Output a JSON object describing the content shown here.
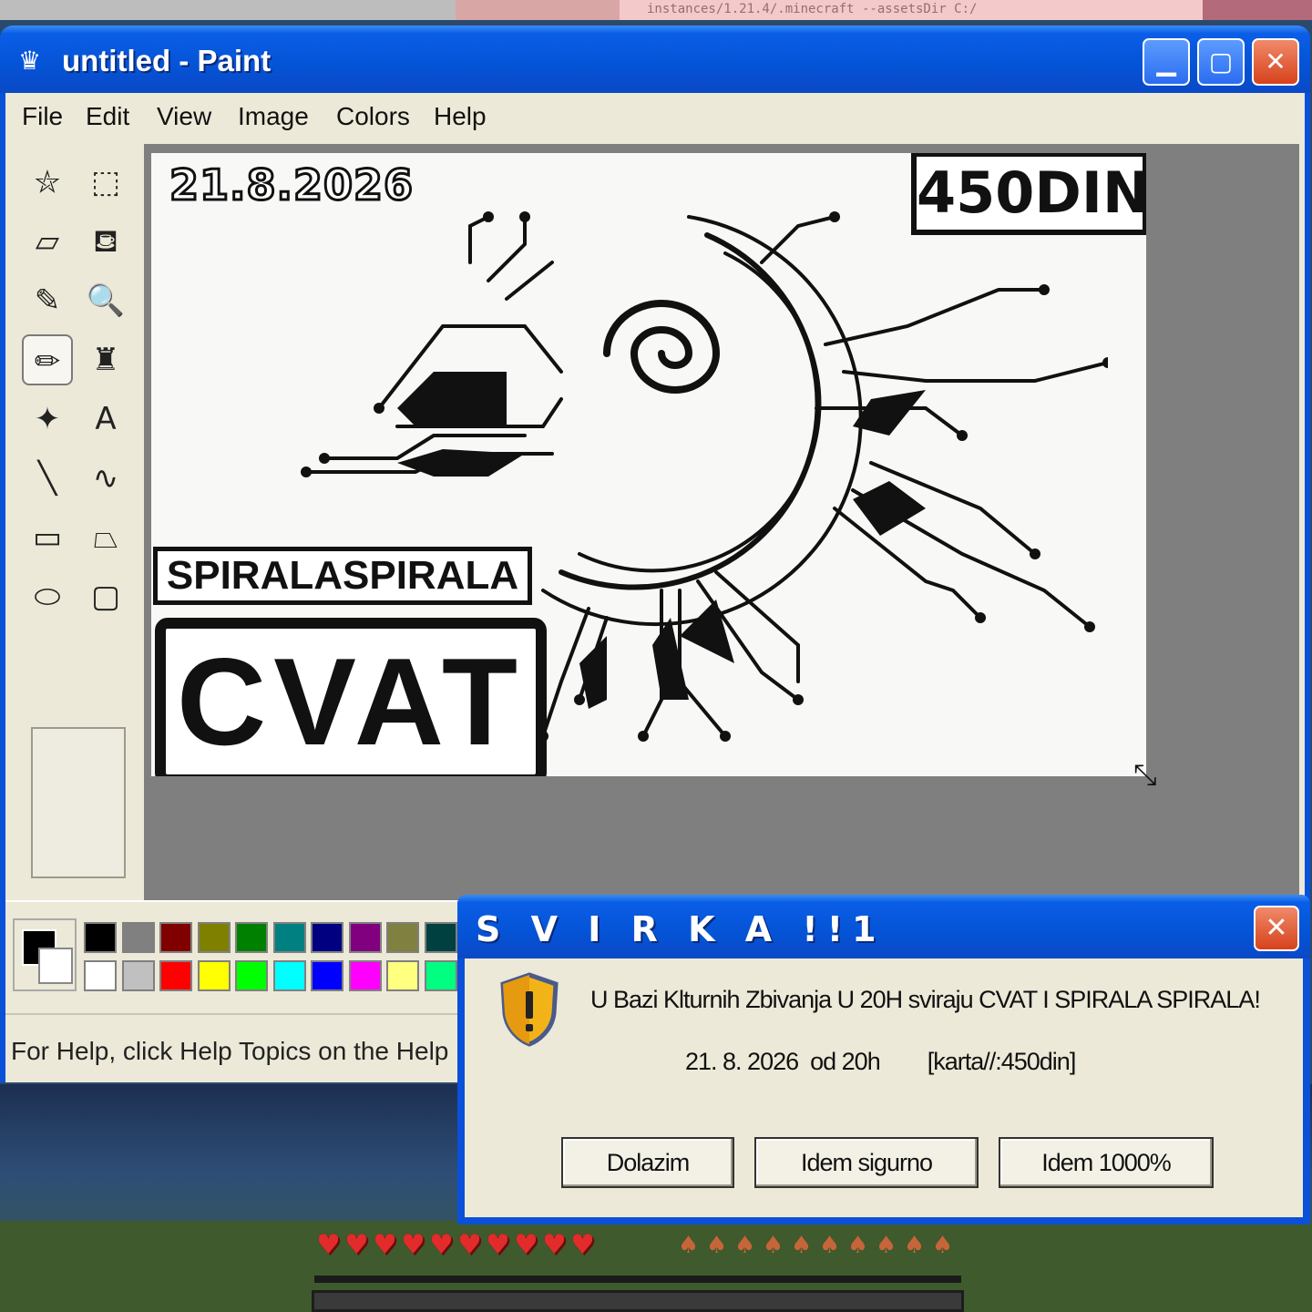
{
  "background": {
    "terminal_text": "instances/1.21.4/.minecraft --assetsDir C:/"
  },
  "paint": {
    "title": "untitled - Paint",
    "menu": [
      "File",
      "Edit",
      "View",
      "Image",
      "Colors",
      "Help"
    ],
    "tools": [
      {
        "name": "free-form-select-icon",
        "glyph": "⛦"
      },
      {
        "name": "rect-select-icon",
        "glyph": "⬚"
      },
      {
        "name": "eraser-icon",
        "glyph": "▱"
      },
      {
        "name": "fill-bucket-icon",
        "glyph": "⛾"
      },
      {
        "name": "eyedropper-icon",
        "glyph": "✎"
      },
      {
        "name": "magnifier-icon",
        "glyph": "🔍"
      },
      {
        "name": "pencil-icon",
        "glyph": "✏"
      },
      {
        "name": "brush-icon",
        "glyph": "♜"
      },
      {
        "name": "airbrush-icon",
        "glyph": "✦"
      },
      {
        "name": "text-icon",
        "glyph": "A"
      },
      {
        "name": "line-icon",
        "glyph": "╲"
      },
      {
        "name": "curve-icon",
        "glyph": "∿"
      },
      {
        "name": "rectangle-icon",
        "glyph": "▭"
      },
      {
        "name": "polygon-icon",
        "glyph": "⏢"
      },
      {
        "name": "ellipse-icon",
        "glyph": "⬭"
      },
      {
        "name": "rounded-rect-icon",
        "glyph": "▢"
      }
    ],
    "active_tool": "pencil-icon",
    "canvas": {
      "date": "21.8.2026",
      "price": "450DIN",
      "band2": "SPIRALASPIRALA",
      "band1": "CVAT"
    },
    "palette_top": [
      "#000000",
      "#808080",
      "#800000",
      "#808000",
      "#008000",
      "#008080",
      "#000080",
      "#800080",
      "#808040",
      "#004040"
    ],
    "palette_bottom": [
      "#ffffff",
      "#c0c0c0",
      "#ff0000",
      "#ffff00",
      "#00ff00",
      "#00ffff",
      "#0000ff",
      "#ff00ff",
      "#ffff80",
      "#00ff80"
    ],
    "status": "For Help, click Help Topics on the Help M"
  },
  "dialog": {
    "title": "S V I R K A !!1",
    "message": "U Bazi Klturnih Zbivanja U 20H sviraju CVAT I SPIRALA SPIRALA!",
    "details": "21. 8. 2026  od 20h        [karta//:450din]",
    "buttons": [
      "Dolazim",
      "Idem sigurno",
      "Idem 1000%"
    ]
  },
  "hud": {
    "hearts": 10,
    "food": 10
  }
}
